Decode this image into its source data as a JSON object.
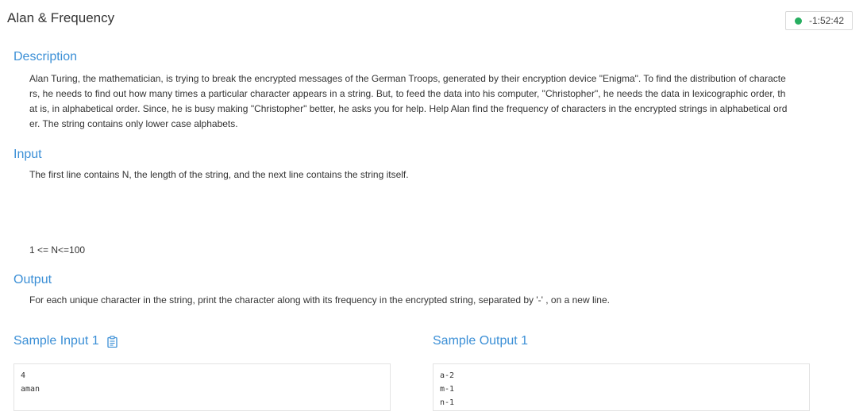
{
  "problem": {
    "title": "Alan & Frequency"
  },
  "timer": {
    "value": "-1:52:42",
    "status_color": "#27ae60"
  },
  "description": {
    "heading": "Description",
    "line1": "Alan Turing, the mathematician, is trying to break the encrypted messages of the German Troops, generated by their encryption device \"Enigma\". To find the distribution of characte",
    "line2": "rs, he needs to find out how many times a particular character appears in a string. But, to feed the data into his computer, \"Christopher\", he needs the data in lexicographic order, th",
    "line3": "at is, in alphabetical order. Since, he is busy making \"Christopher\" better, he asks you for help. Help Alan find the frequency of characters in the encrypted strings in alphabetical ord",
    "line4": "er. The string contains only lower case alphabets."
  },
  "input": {
    "heading": "Input",
    "text": "The first line contains N, the length of the string, and the next line contains the string itself.",
    "constraint": "1 <= N<=100"
  },
  "output": {
    "heading": "Output",
    "text": "For each unique character in the string, print the character along with its frequency in the encrypted string, separated by '-' , on a new line."
  },
  "samples": {
    "input_heading": "Sample Input 1",
    "output_heading": "Sample Output 1",
    "copy_icon": "clipboard-icon",
    "input_lines": [
      "4",
      "aman"
    ],
    "output_lines": [
      "a-2",
      "m-1",
      "n-1"
    ]
  },
  "colors": {
    "accent": "#3b8fd6",
    "text": "#333333"
  }
}
